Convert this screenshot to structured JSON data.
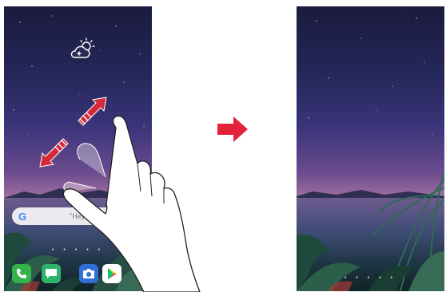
{
  "left_screen": {
    "search": {
      "logo": "G",
      "placeholder": "\"Hey"
    },
    "dock_apps": [
      {
        "name": "phone",
        "color": "#35b34a"
      },
      {
        "name": "messages",
        "color": "#2fb36b"
      },
      {
        "name": "camera",
        "color": "#2f6fd6"
      },
      {
        "name": "play-store",
        "color": "#ffffff"
      }
    ],
    "weather_icon": "cloud-sun-icon",
    "gesture": "pinch-out"
  },
  "transition_arrow_color": "#e2243b",
  "gesture_arrow_color": "#d62a3a",
  "right_screen": {
    "description": ""
  }
}
